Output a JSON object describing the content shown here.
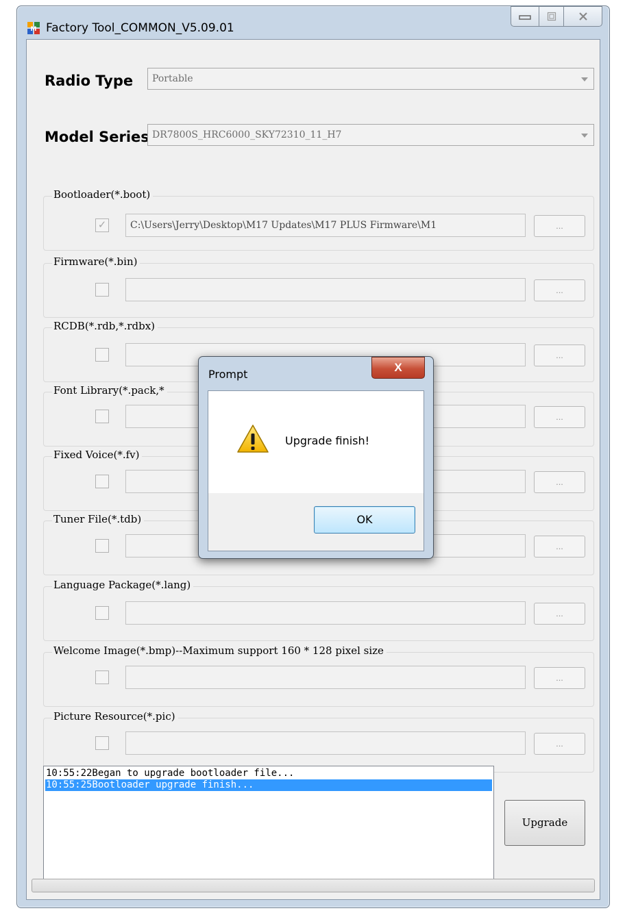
{
  "window": {
    "title": "Factory Tool_COMMON_V5.09.01",
    "controls": {
      "minimize": "▭",
      "maximize": "▫",
      "close": "✕"
    }
  },
  "radio_type": {
    "label": "Radio Type",
    "value": "Portable"
  },
  "model_series": {
    "label": "Model Series",
    "value": "DR7800S_HRC6000_SKY72310_11_H7"
  },
  "browse_label": "...",
  "groups": [
    {
      "label": "Bootloader(*.boot)",
      "checked": true,
      "path": "C:\\Users\\Jerry\\Desktop\\M17 Updates\\M17 PLUS Firmware\\M1"
    },
    {
      "label": "Firmware(*.bin)",
      "checked": false,
      "path": ""
    },
    {
      "label": "RCDB(*.rdb,*.rdbx)",
      "checked": false,
      "path": ""
    },
    {
      "label": "Font Library(*.pack,*",
      "checked": false,
      "path": ""
    },
    {
      "label": "Fixed Voice(*.fv)",
      "checked": false,
      "path": ""
    },
    {
      "label": "Tuner File(*.tdb)",
      "checked": false,
      "path": ""
    },
    {
      "label": "Language Package(*.lang)",
      "checked": false,
      "path": ""
    },
    {
      "label": "Welcome Image(*.bmp)--Maximum support 160 * 128 pixel size",
      "checked": false,
      "path": ""
    },
    {
      "label": "Picture Resource(*.pic)",
      "checked": false,
      "path": ""
    }
  ],
  "log": [
    {
      "text": "10:55:22Began to upgrade bootloader file...",
      "selected": false
    },
    {
      "text": "10:55:25Bootloader upgrade finish...",
      "selected": true
    }
  ],
  "upgrade_button": "Upgrade",
  "dialog": {
    "title": "Prompt",
    "close": "X",
    "message": "Upgrade finish!",
    "ok": "OK",
    "icon": "warning-icon"
  },
  "colors": {
    "window_frame": "#c7d6e6",
    "selection": "#3399ff",
    "close_button": "#c75038"
  }
}
